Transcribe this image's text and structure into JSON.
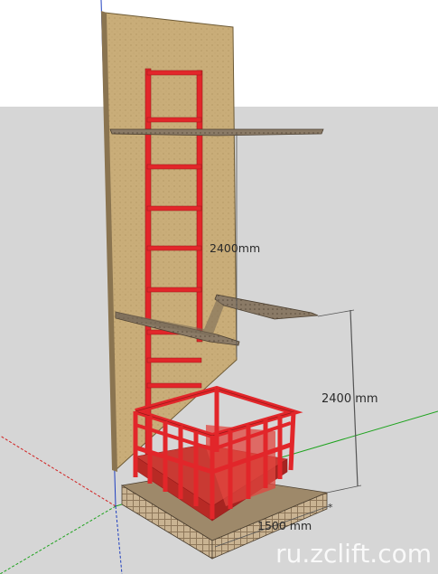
{
  "dimensions": {
    "upper_height_label": "2400mm",
    "lower_height_label": "2400 mm",
    "platform_width_label": "1500 mm"
  },
  "watermark": "ru.zclift.com",
  "colors": {
    "sky": "#ffffff",
    "ground": "#d6d6d6",
    "wall": "#c9ad79",
    "frame": "#e2262a",
    "frame_dark": "#9a1a1a",
    "slab": "#8a7a66",
    "base": "#b59e80"
  },
  "icons": {
    "axis_origin": "scene-axes-icon"
  }
}
